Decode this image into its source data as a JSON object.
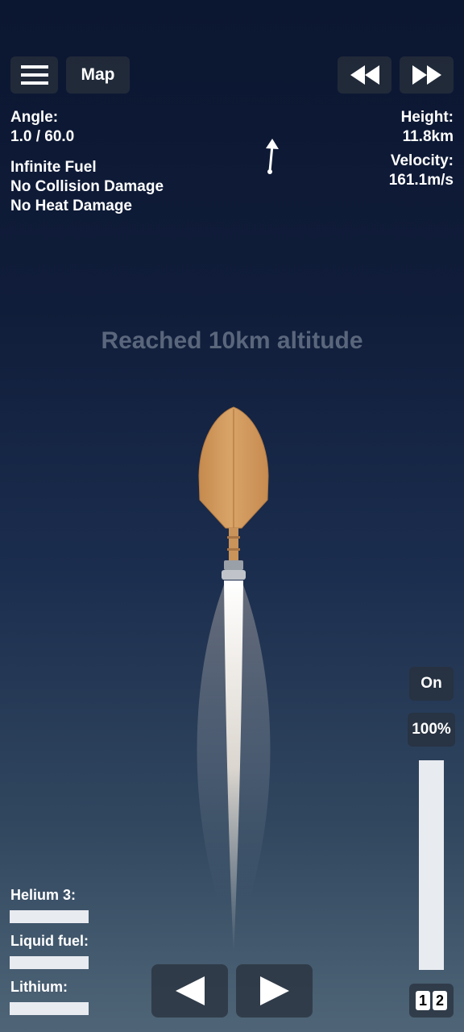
{
  "toolbar": {
    "menu_icon": "hamburger-icon",
    "map_label": "Map",
    "rewind_icon": "rewind-icon",
    "fast_forward_icon": "fast-forward-icon"
  },
  "info": {
    "angle_label": "Angle:",
    "angle_value": "1.0 / 60.0",
    "cheats": [
      "Infinite Fuel",
      "No Collision Damage",
      "No Heat Damage"
    ],
    "height_label": "Height:",
    "height_value": "11.8km",
    "velocity_label": "Velocity:",
    "velocity_value": "161.1m/s"
  },
  "message": "Reached 10km altitude",
  "throttle": {
    "state_label": "On",
    "percent_label": "100%",
    "level": 1.0
  },
  "resources": [
    {
      "label": "Helium 3:",
      "level": 1.0
    },
    {
      "label": "Liquid fuel:",
      "level": 1.0
    },
    {
      "label": "Lithium:",
      "level": 1.0
    }
  ],
  "controls": {
    "left_icon": "rotate-left-icon",
    "right_icon": "rotate-right-icon"
  },
  "stage": {
    "digits": [
      "1",
      "2"
    ]
  },
  "colors": {
    "button_bg": "#28303c",
    "rocket_body": "#d49a5c",
    "bar": "#e8ebf0"
  }
}
